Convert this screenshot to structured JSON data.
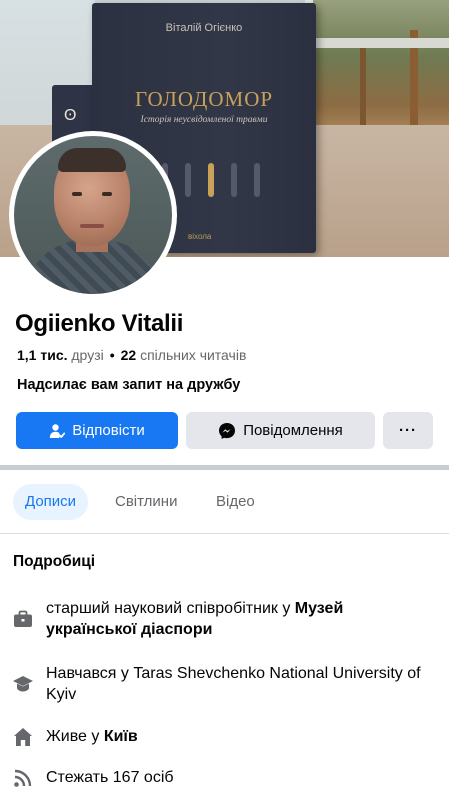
{
  "cover": {
    "book_author": "Віталій Огієнко",
    "book_title": "ГОЛОДОМОР",
    "book_subtitle": "Історія неусвідомленої травми",
    "book_publisher": "віхола"
  },
  "profile": {
    "name": "Ogiienko Vitalii",
    "friends_count": "1,1 тис.",
    "friends_label": "друзі",
    "separator": "•",
    "mutual_count": "22",
    "mutual_label": "спільних читачів",
    "request_text": "Надсилає вам запит на дружбу"
  },
  "actions": {
    "reply_label": "Відповісти",
    "message_label": "Повідомлення",
    "more_label": "···"
  },
  "tabs": [
    {
      "label": "Дописи",
      "active": true
    },
    {
      "label": "Світлини",
      "active": false
    },
    {
      "label": "Відео",
      "active": false
    }
  ],
  "details": {
    "title": "Подробиці",
    "work_prefix": "старший науковий співробітник у ",
    "work_place": "Музей української діаспори",
    "education": "Навчався у Taras Shevchenko National University of Kyiv",
    "lives_prefix": "Живе у ",
    "lives_city": "Київ",
    "followers": "Стежать 167 осіб"
  },
  "icons": {
    "reply": "person-check-icon",
    "message": "messenger-icon",
    "work": "briefcase-icon",
    "education": "graduation-cap-icon",
    "home": "house-icon",
    "followers": "rss-feed-icon"
  },
  "colors": {
    "accent": "#1877f2",
    "secondary_button": "#e4e6eb",
    "text_secondary": "#65676b",
    "active_tab_bg": "#e7f3ff"
  }
}
